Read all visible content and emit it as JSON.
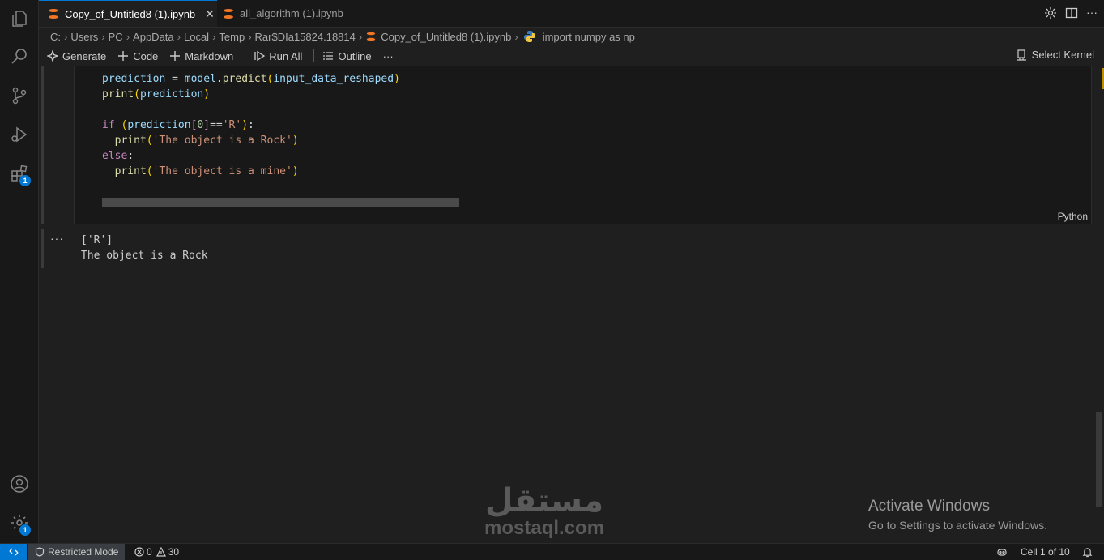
{
  "tabs": [
    {
      "label": "Copy_of_Untitled8 (1).ipynb",
      "active": true
    },
    {
      "label": "all_algorithm (1).ipynb",
      "active": false
    }
  ],
  "breadcrumb": [
    "C:",
    "Users",
    "PC",
    "AppData",
    "Local",
    "Temp",
    "Rar$DIa15824.18814",
    "Copy_of_Untitled8 (1).ipynb",
    "import numpy as np"
  ],
  "toolbar": {
    "generate": "Generate",
    "code": "Code",
    "markdown": "Markdown",
    "run_all": "Run All",
    "outline": "Outline",
    "more": "···",
    "select_kernel": "Select Kernel"
  },
  "cell": {
    "language": "Python",
    "code_lines": [
      "prediction = model.predict(input_data_reshaped)",
      "print(prediction)",
      "",
      "if (prediction[0]=='R'):",
      "  print('The object is a Rock')",
      "else:",
      "  print('The object is a mine')"
    ]
  },
  "output": {
    "dots": "···",
    "lines": [
      "['R']",
      "The object is a Rock"
    ]
  },
  "activation": {
    "title": "Activate Windows",
    "subtitle": "Go to Settings to activate Windows."
  },
  "watermark": {
    "arabic": "مستقل",
    "latin": "mostaql.com"
  },
  "activity_badges": {
    "extensions": "1",
    "settings": "1"
  },
  "status": {
    "restricted": "Restricted Mode",
    "errors": "0",
    "warnings": "30",
    "cell_position": "Cell 1 of 10"
  },
  "colors": {
    "accent": "#0078d4",
    "background": "#1f1f1f",
    "sidebar": "#181818"
  }
}
